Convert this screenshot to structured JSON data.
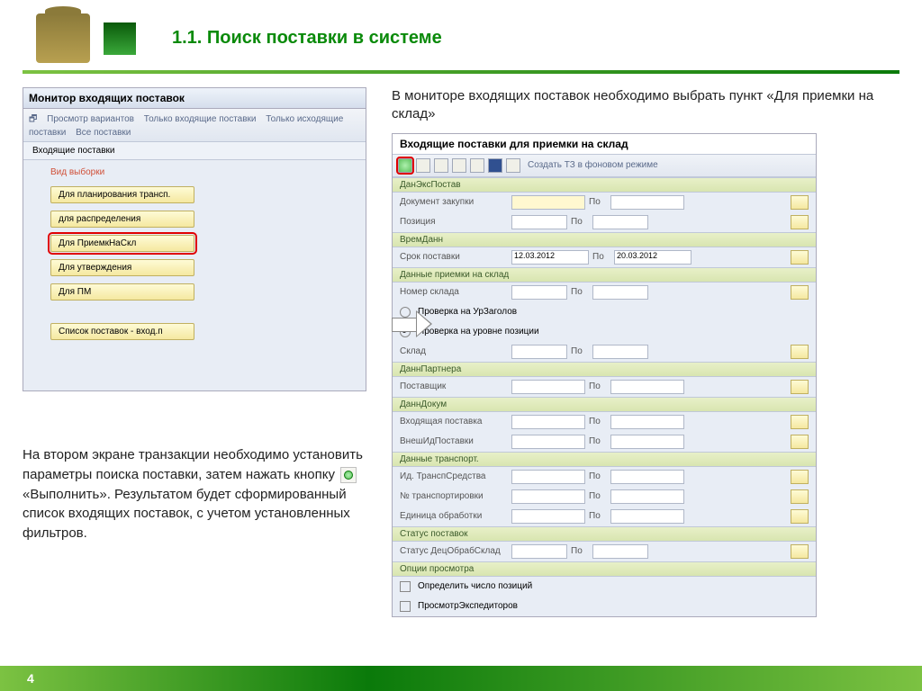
{
  "slide": {
    "title": "1.1. Поиск поставки в системе",
    "page_number": "4"
  },
  "intro": "В мониторе входящих поставок необходимо выбрать пункт «Для приемки на склад»",
  "bottom_pre": "На втором экране транзакции необходимо установить параметры поиска поставки, затем нажать кнопку ",
  "bottom_post": " «Выполнить». Результатом будет сформированный список входящих поставок, с учетом установленных фильтров.",
  "left": {
    "window_title": "Монитор входящих поставок",
    "toolbar": [
      "Просмотр вариантов",
      "Только входящие поставки",
      "Только исходящие поставки",
      "Все поставки"
    ],
    "tab": "Входящие поставки",
    "frame": "Вид выборки",
    "buttons": [
      "Для планирования трансп.",
      "для распределения",
      "Для ПриемкНаСкл",
      "Для утверждения",
      "Для ПМ",
      "Список поставок - вход.п"
    ]
  },
  "right": {
    "title": "Входящие поставки для приемки на склад",
    "toolbar_text": "Создать ТЗ в фоновом режиме",
    "sections": {
      "s1": {
        "h": "ДанЭксПостав",
        "doc": "Документ закупки",
        "pos": "Позиция",
        "po": "По"
      },
      "s2": {
        "h": "ВремДанн",
        "srok": "Срок поставки",
        "d1": "12.03.2012",
        "d2": "20.03.2012",
        "po": "По"
      },
      "s3": {
        "h": "Данные приемки на склад",
        "nomer": "Номер склада",
        "r1": "Проверка на УрЗаголов",
        "r2": "Проверка на уровне позиции",
        "sklad": "Склад",
        "po": "По"
      },
      "s4": {
        "h": "ДаннПартнера",
        "post": "Поставщик",
        "po": "По"
      },
      "s5": {
        "h": "ДаннДокум",
        "vh": "Входящая поставка",
        "vn": "ВнешИдПоставки",
        "po": "По"
      },
      "s6": {
        "h": "Данные транспорт.",
        "id": "Ид. ТранспСредства",
        "nt": "№ транспортировки",
        "ed": "Единица обработки",
        "po": "По"
      },
      "s7": {
        "h": "Статус поставок",
        "st": "Статус ДецОбрабСклад",
        "po": "По"
      },
      "s8": {
        "h": "Опции просмотра",
        "o1": "Определить число позиций",
        "o2": "ПросмотрЭкспедиторов"
      }
    }
  }
}
